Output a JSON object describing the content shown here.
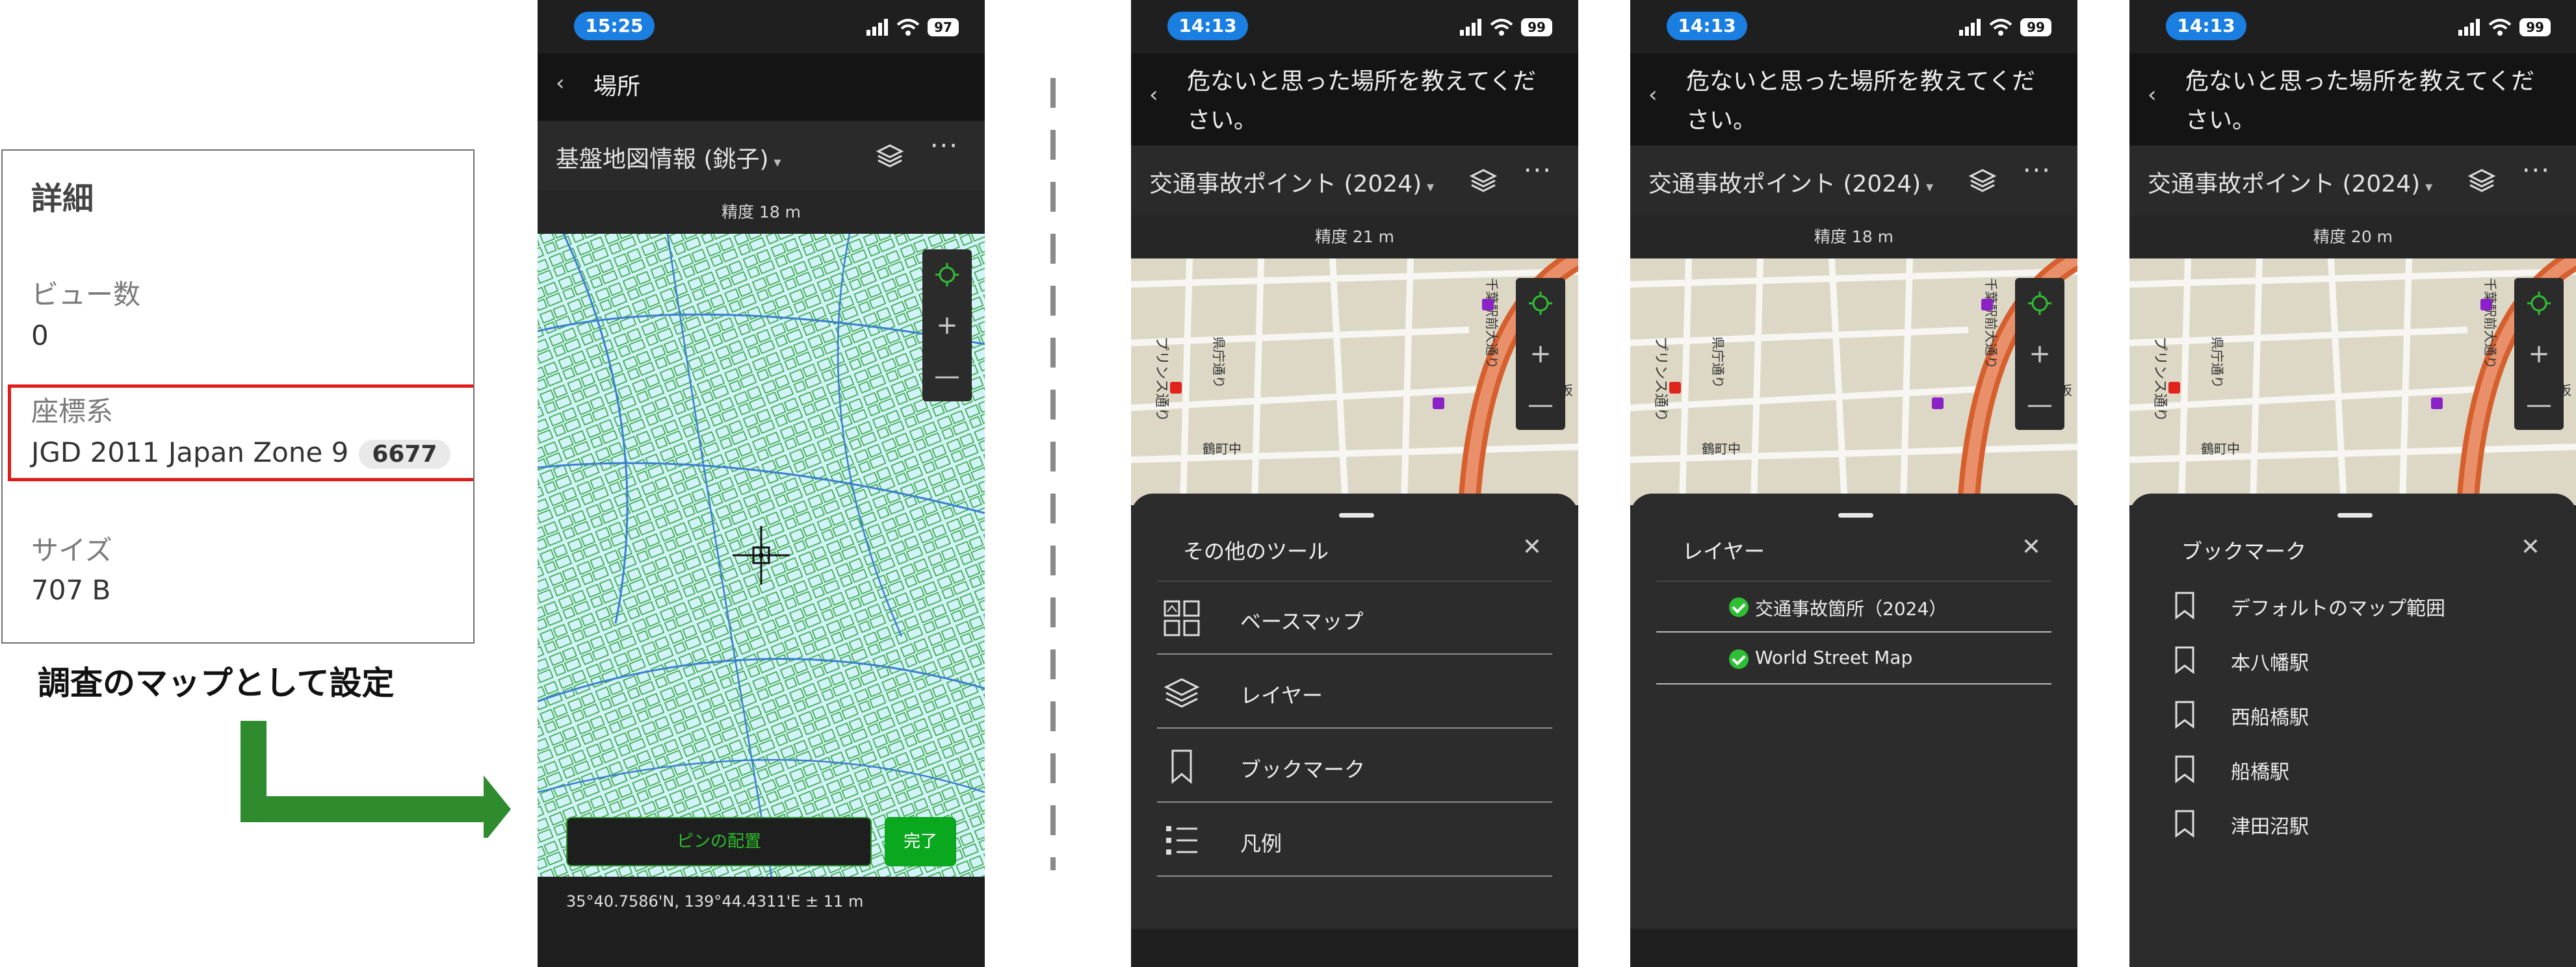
{
  "details": {
    "title": "詳細",
    "views_label": "ビュー数",
    "views_value": "0",
    "crs_label": "座標系",
    "crs_value": "JGD 2011 Japan Zone 9",
    "crs_code": "6677",
    "size_label": "サイズ",
    "size_value": "707 B"
  },
  "annotation": {
    "set_as_survey_map": "調査のマップとして設定"
  },
  "phone1": {
    "time": "15:25",
    "battery": "97",
    "nav_title": "場所",
    "map_name": "基盤地図情報 (銚子)",
    "accuracy": "精度 18 m",
    "pin_button": "ピンの配置",
    "done_button": "完了",
    "coordinates": "35°40.7586'N, 139°44.4311'E ± 11 m"
  },
  "phone2": {
    "time": "14:13",
    "battery": "99",
    "nav_title": "危ないと思った場所を教えてください。",
    "map_name": "交通事故ポイント (2024)",
    "accuracy": "精度 21 m",
    "sheet_title": "その他のツール",
    "items": [
      {
        "label": "ベースマップ",
        "icon": "basemap-icon"
      },
      {
        "label": "レイヤー",
        "icon": "layers-icon"
      },
      {
        "label": "ブックマーク",
        "icon": "bookmark-icon"
      },
      {
        "label": "凡例",
        "icon": "legend-icon"
      }
    ]
  },
  "phone3": {
    "time": "14:13",
    "battery": "99",
    "nav_title": "危ないと思った場所を教えてください。",
    "map_name": "交通事故ポイント (2024)",
    "accuracy": "精度 18 m",
    "sheet_title": "レイヤー",
    "layers": [
      {
        "label": "交通事故箇所（2024）",
        "checked": true
      },
      {
        "label": "World Street Map",
        "checked": true
      }
    ]
  },
  "phone4": {
    "time": "14:13",
    "battery": "99",
    "nav_title": "危ないと思った場所を教えてください。",
    "map_name": "交通事故ポイント (2024)",
    "accuracy": "精度 20 m",
    "sheet_title": "ブックマーク",
    "bookmarks": [
      {
        "label": "デフォルトのマップ範囲"
      },
      {
        "label": "本八幡駅"
      },
      {
        "label": "西船橋駅"
      },
      {
        "label": "船橋駅"
      },
      {
        "label": "津田沼駅"
      }
    ]
  },
  "map_labels": {
    "street1": "プリンス通り",
    "street2": "県庁通り",
    "station_st": "千葉駅前大通り",
    "town": "鶴町中",
    "zaka": "坂"
  },
  "colors": {
    "accent_blue": "#1a7fe0",
    "check_green": "#2fbf35",
    "arrow_green": "#2e8b2e",
    "highlight_red": "#e11b1b"
  }
}
